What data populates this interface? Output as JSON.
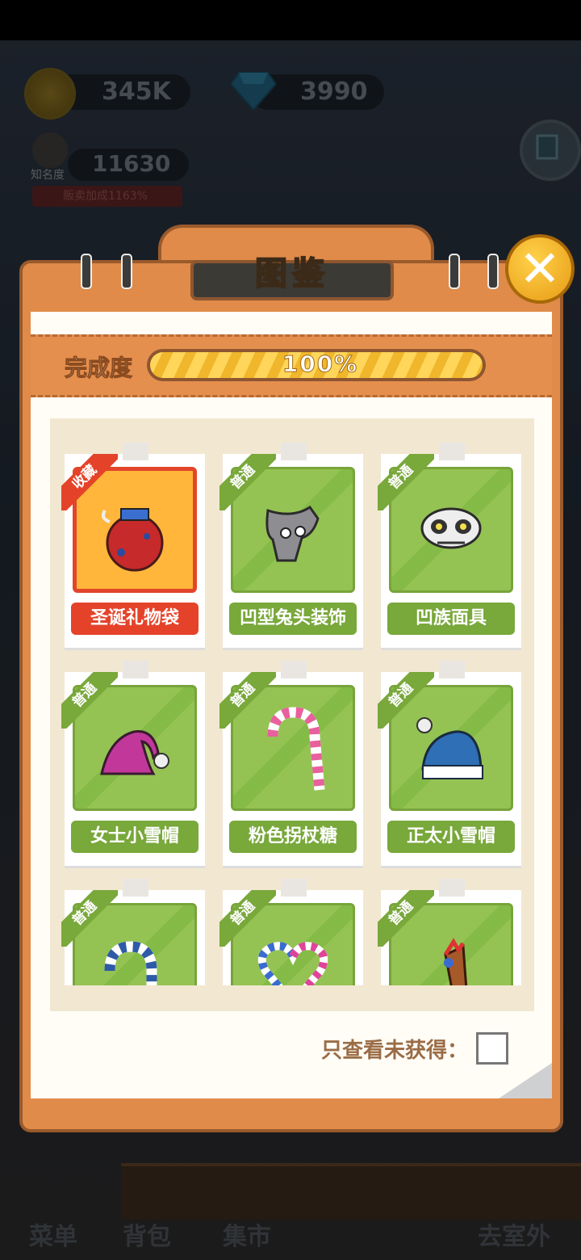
{
  "hud": {
    "coins": "345K",
    "gems": "3990",
    "fame_label": "知名度",
    "fame": "11630",
    "sale_bonus": "贩卖加成1163%"
  },
  "nav": {
    "menu": "菜单",
    "bag": "背包",
    "market": "集市",
    "outdoor": "去室外"
  },
  "modal": {
    "title": "图鉴",
    "close_symbol": "✕",
    "progress_label": "完成度",
    "progress_value": "100%",
    "progress_fraction": 1.0,
    "filter_label": "只查看未获得：",
    "filter_checked": false
  },
  "items": [
    {
      "name": "圣诞礼物袋",
      "tag": "收藏",
      "style": "gold",
      "icon": "gift-bag-icon"
    },
    {
      "name": "凹型兔头装饰",
      "tag": "普通",
      "style": "green",
      "icon": "rabbit-head-icon"
    },
    {
      "name": "凹族面具",
      "tag": "普通",
      "style": "green",
      "icon": "skull-mask-icon"
    },
    {
      "name": "女士小雪帽",
      "tag": "普通",
      "style": "green",
      "icon": "pink-santa-hat-icon"
    },
    {
      "name": "粉色拐杖糖",
      "tag": "普通",
      "style": "green",
      "icon": "pink-candy-cane-icon"
    },
    {
      "name": "正太小雪帽",
      "tag": "普通",
      "style": "green",
      "icon": "blue-beanie-icon"
    },
    {
      "name": "",
      "tag": "普通",
      "style": "green",
      "icon": "blue-candy-cane-icon"
    },
    {
      "name": "",
      "tag": "普通",
      "style": "green",
      "icon": "candy-heart-icon"
    },
    {
      "name": "",
      "tag": "普通",
      "style": "green",
      "icon": "torch-icon"
    }
  ]
}
